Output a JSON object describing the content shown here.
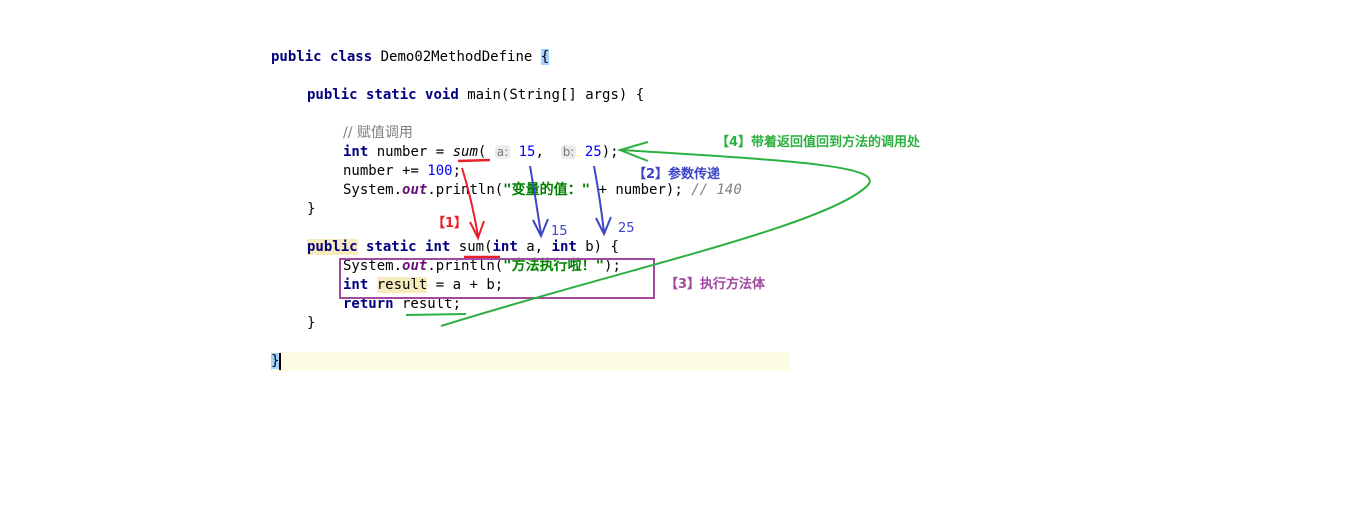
{
  "code": {
    "class_line": {
      "kw1": "public",
      "kw2": "class",
      "name": "Demo02MethodDefine",
      "brace": "{"
    },
    "main_sig": {
      "kw1": "public",
      "kw2": "static",
      "kw3": "void",
      "rest": "main(String[] args) {"
    },
    "comment": "// 赋值调用",
    "call_line": {
      "type": "int",
      "pre": "number = ",
      "method": "sum",
      "open": "(",
      "hint_a": "a:",
      "val_a": "15",
      "comma": ",",
      "hint_b": "b:",
      "val_b": "25",
      "close": ");"
    },
    "add_line": {
      "pre": "number += ",
      "val": "100",
      "semi": ";"
    },
    "print_line": {
      "pre": "System.",
      "field": "out",
      "mid": ".println(",
      "str": "\"变量的值：\"",
      "post": " + number); ",
      "comment": "// 140"
    },
    "main_close": "}",
    "sum_sig": {
      "kw1": "public",
      "kw2": "static",
      "kw3": "int",
      "method": "sum",
      "open": "(",
      "t1": "int",
      "p1": " a, ",
      "t2": "int",
      "p2": " b) {"
    },
    "sum_print": {
      "pre": "System.",
      "field": "out",
      "mid": ".println(",
      "str": "\"方法执行啦！\"",
      "post": ");"
    },
    "result_line": {
      "type": "int",
      "var": "result",
      "post": " = a + b;"
    },
    "return_line": {
      "kw": "return",
      "post": " result;"
    },
    "sum_close": "}",
    "class_close": "}"
  },
  "annotations": {
    "step1": "【1】",
    "step2": "【2】参数传递",
    "step3": "【3】执行方法体",
    "step4": "【4】带着返回值回到方法的调用处",
    "arg_a": "15",
    "arg_b": "25"
  },
  "colors": {
    "red": "#e8202a",
    "blue": "#3c46c8",
    "purple": "#a04aa0",
    "green": "#2db040"
  }
}
